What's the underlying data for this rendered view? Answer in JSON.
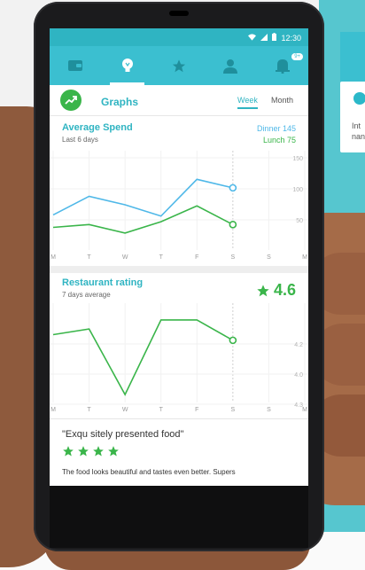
{
  "status_bar": {
    "time": "12:30"
  },
  "tabs": [
    {
      "name": "wallet",
      "active": false
    },
    {
      "name": "ideas",
      "active": true
    },
    {
      "name": "favorites",
      "active": false
    },
    {
      "name": "profile",
      "active": false
    },
    {
      "name": "notifications",
      "active": false,
      "badge": "9+"
    }
  ],
  "header": {
    "title": "Graphs",
    "period_week": "Week",
    "period_month": "Month"
  },
  "spend": {
    "title": "Average Spend",
    "subtitle": "Last 6 days",
    "legend_dinner": "Dinner 145",
    "legend_lunch": "Lunch 75"
  },
  "rating": {
    "title": "Restaurant rating",
    "subtitle": "7 days average",
    "value": "4.6"
  },
  "review": {
    "quote": "\"Exqu sitely presented food\"",
    "stars": 4,
    "text": "The food looks beautiful and tastes even better. Supers"
  },
  "background_card": {
    "text_line1": "Int",
    "text_line2": "nan"
  },
  "colors": {
    "accent": "#3bbfd0",
    "dinner": "#4fb8e8",
    "lunch": "#3ab54a"
  },
  "chart_data": [
    {
      "type": "line",
      "x": [
        "M",
        "T",
        "W",
        "T",
        "F",
        "S",
        "S",
        "M"
      ],
      "yticks": [
        "150",
        "100",
        "50"
      ],
      "series": [
        {
          "name": "Dinner",
          "values": [
            62,
            95,
            80,
            60,
            125,
            110
          ]
        },
        {
          "name": "Lunch",
          "values": [
            40,
            45,
            30,
            50,
            78,
            45
          ]
        }
      ],
      "ylim": [
        0,
        160
      ]
    },
    {
      "type": "line",
      "x": [
        "M",
        "T",
        "W",
        "T",
        "F",
        "S",
        "S",
        "M"
      ],
      "yticks": [
        "4.2",
        "4.0",
        "4.3",
        "4.1"
      ],
      "series": [
        {
          "values": [
            4.65,
            4.7,
            4.12,
            4.78,
            4.78,
            4.6
          ]
        }
      ],
      "ylim": [
        4.05,
        4.85
      ]
    }
  ]
}
